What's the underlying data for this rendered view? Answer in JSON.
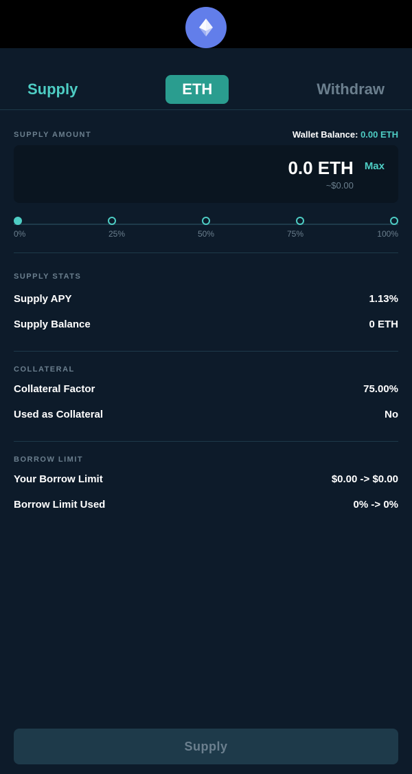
{
  "topBar": {
    "ethLogoAlt": "Ethereum logo"
  },
  "tabs": {
    "supply": "Supply",
    "eth": "ETH",
    "withdraw": "Withdraw"
  },
  "supplyAmount": {
    "label": "SUPPLY AMOUNT",
    "walletBalancePrefix": "Wallet Balance: ",
    "walletBalanceValue": "0.00 ETH",
    "amountETH": "0.0 ETH",
    "amountUSD": "~$0.00",
    "maxLabel": "Max"
  },
  "percentages": [
    "0%",
    "25%",
    "50%",
    "75%",
    "100%"
  ],
  "supplyStats": {
    "sectionLabel": "SUPPLY STATS",
    "rows": [
      {
        "key": "Supply APY",
        "value": "1.13%"
      },
      {
        "key": "Supply Balance",
        "value": "0 ETH"
      }
    ]
  },
  "collateral": {
    "sectionLabel": "COLLATERAL",
    "rows": [
      {
        "key": "Collateral Factor",
        "value": "75.00%"
      },
      {
        "key": "Used as Collateral",
        "value": "No"
      }
    ]
  },
  "borrowLimit": {
    "sectionLabel": "BORROW LIMIT",
    "rows": [
      {
        "key": "Your Borrow Limit",
        "value": "$0.00 -> $0.00"
      },
      {
        "key": "Borrow Limit Used",
        "value": "0% -> 0%"
      }
    ]
  },
  "supplyButton": {
    "label": "Supply"
  }
}
